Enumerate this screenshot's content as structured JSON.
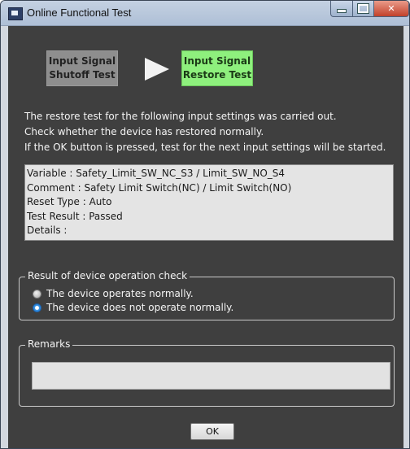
{
  "window": {
    "title": "Online Functional Test"
  },
  "steps": {
    "shutoff": {
      "line1": "Input Signal",
      "line2": "Shutoff Test"
    },
    "restore": {
      "line1": "Input Signal",
      "line2": "Restore Test"
    }
  },
  "message": {
    "line1": "The restore test for the following input settings was carried out.",
    "line2": "Check whether the device has restored normally.",
    "line3": "If the OK button is pressed, test for the next input settings will be started."
  },
  "details": [
    "Variable : Safety_Limit_SW_NC_S3 / Limit_SW_NO_S4",
    "Comment : Safety Limit Switch(NC) / Limit Switch(NO)",
    "Reset Type : Auto",
    "Test Result : Passed",
    "Details :"
  ],
  "check": {
    "label": "Result of device operation check",
    "options": [
      "The device operates normally.",
      "The device does not operate normally."
    ],
    "selected_index": 1
  },
  "remarks": {
    "label": "Remarks",
    "value": ""
  },
  "buttons": {
    "ok": "OK"
  },
  "colors": {
    "restore_step": "#8ef07d",
    "shutoff_step": "#8e8e8e",
    "client_bg": "#3f3f3f"
  }
}
